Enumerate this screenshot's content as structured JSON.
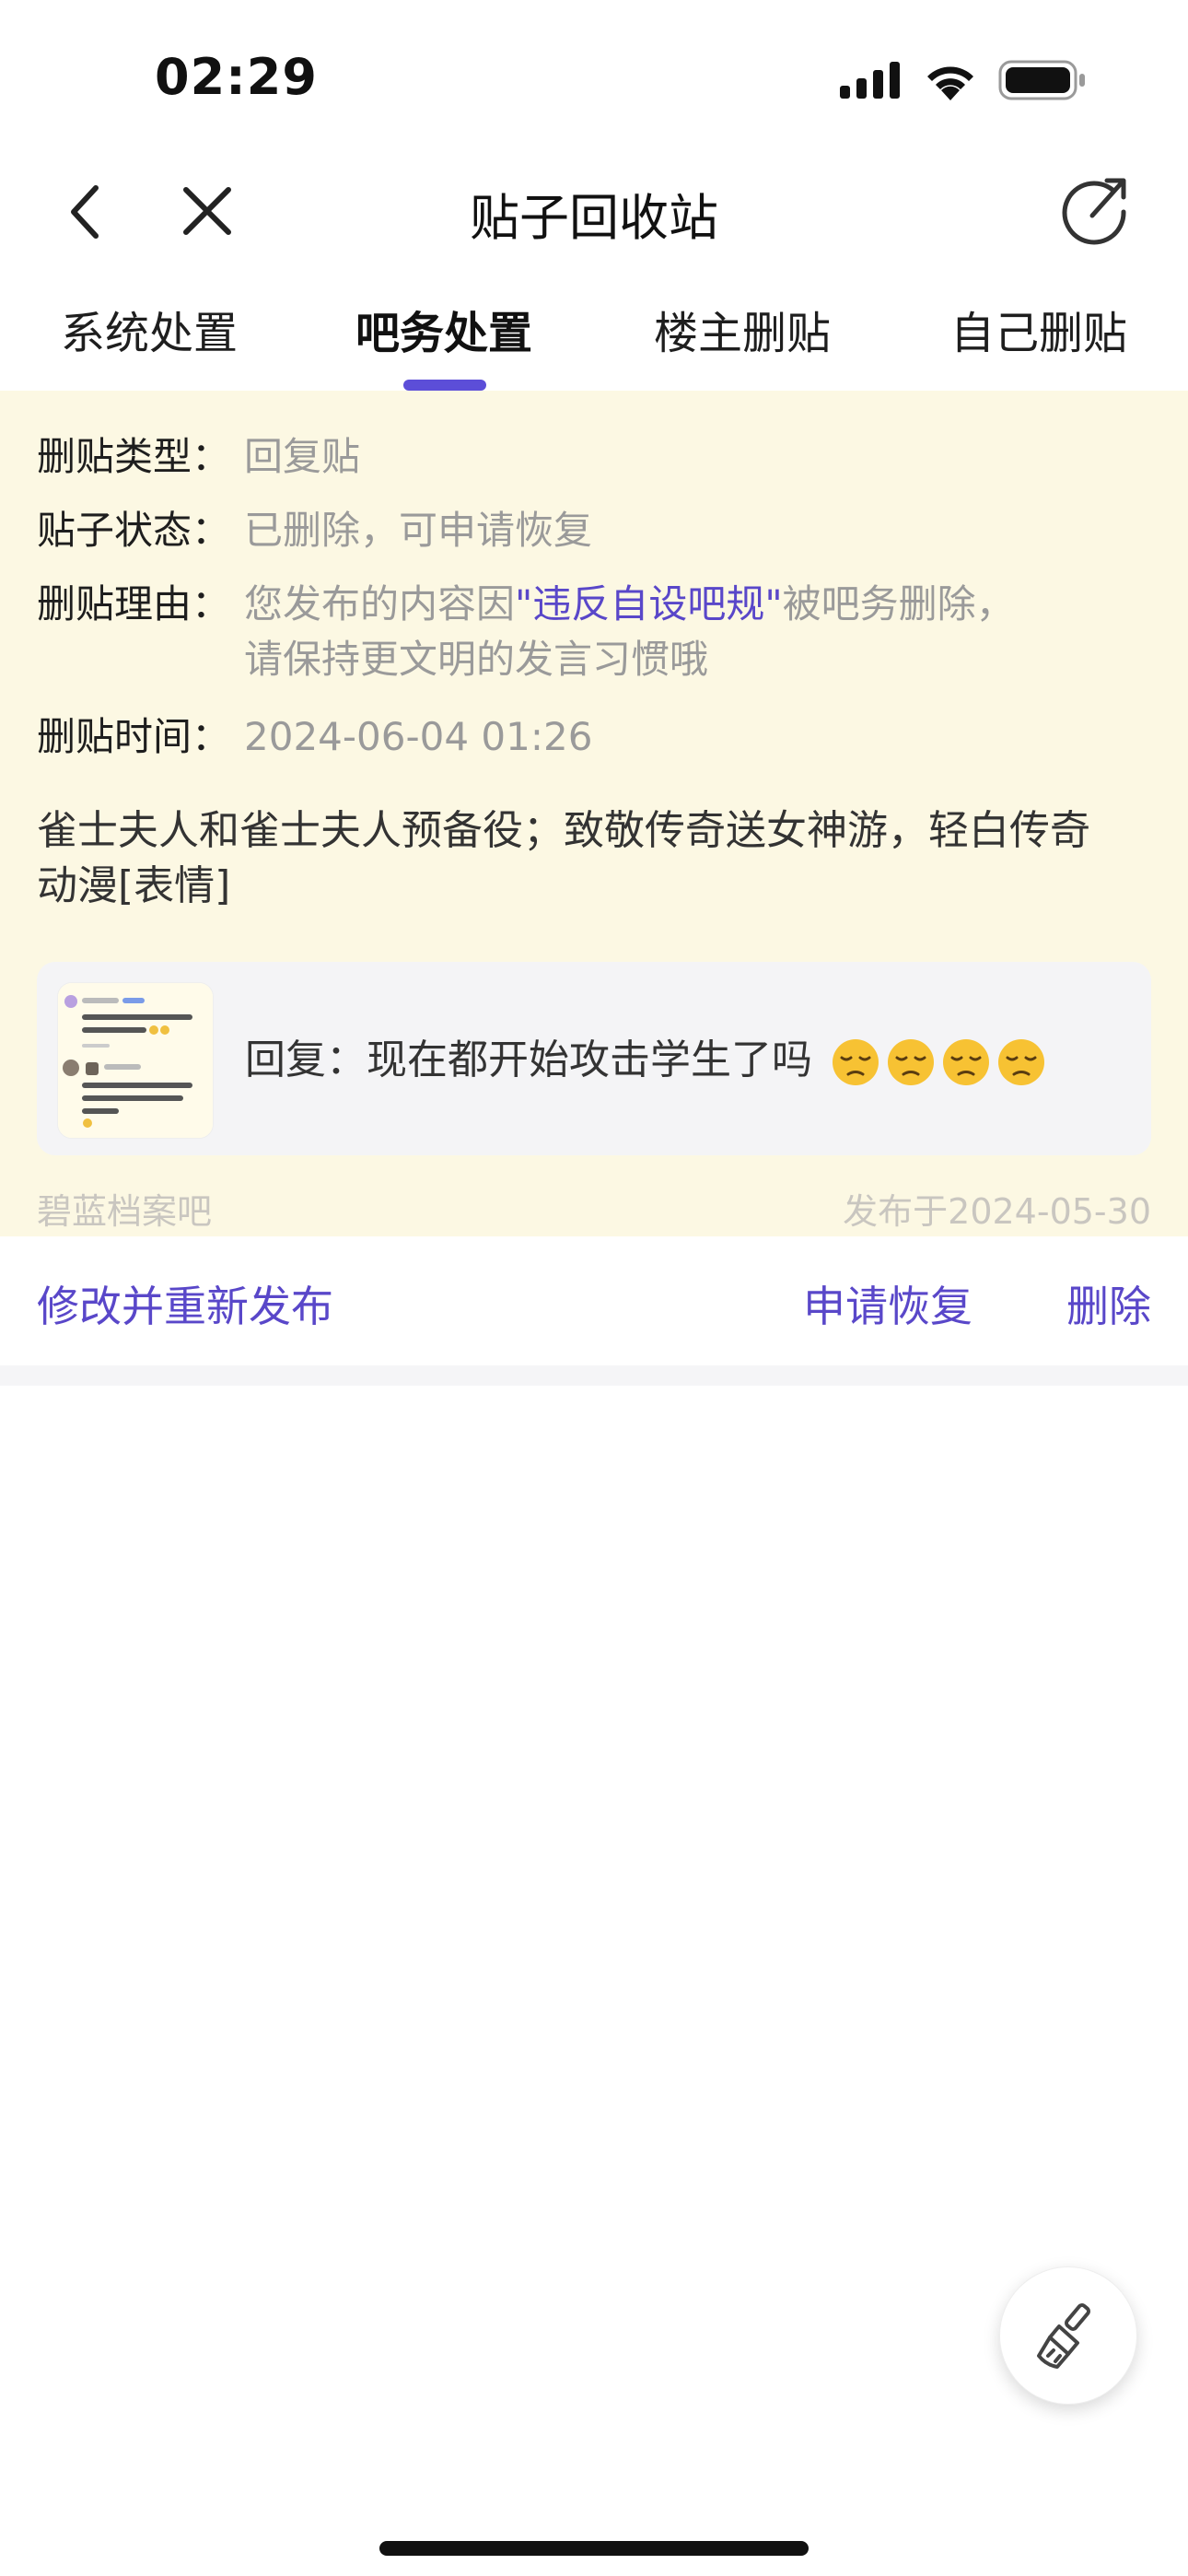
{
  "status_bar": {
    "time": "02:29"
  },
  "nav": {
    "title": "贴子回收站"
  },
  "tabs": [
    {
      "label": "系统处置",
      "active": false
    },
    {
      "label": "吧务处置",
      "active": true
    },
    {
      "label": "楼主删贴",
      "active": false
    },
    {
      "label": "自己删贴",
      "active": false
    }
  ],
  "card": {
    "type_label": "删贴类型：",
    "type_value": "回复贴",
    "status_label": "贴子状态：",
    "status_value": "已删除，可申请恢复",
    "reason_label": "删贴理由：",
    "reason_prefix": "您发布的内容因",
    "reason_highlight": "\"违反自设吧规\"",
    "reason_suffix": "被吧务删除，",
    "reason_line2": "请保持更文明的发言习惯哦",
    "time_label": "删贴时间：",
    "time_value": "2024-06-04 01:26",
    "body_line1": "雀士夫人和雀士夫人预备役；致敬传奇送女神游，轻白传奇",
    "body_line2": "动漫[表情]",
    "quote_text": "回复：现在都开始攻击学生了吗",
    "forum": "碧蓝档案吧",
    "published": "发布于2024-05-30"
  },
  "actions": {
    "edit_republish": "修改并重新发布",
    "restore": "申请恢复",
    "delete": "删除"
  },
  "colors": {
    "accent": "#5c4ed8",
    "card_bg": "#fcf8e3"
  }
}
